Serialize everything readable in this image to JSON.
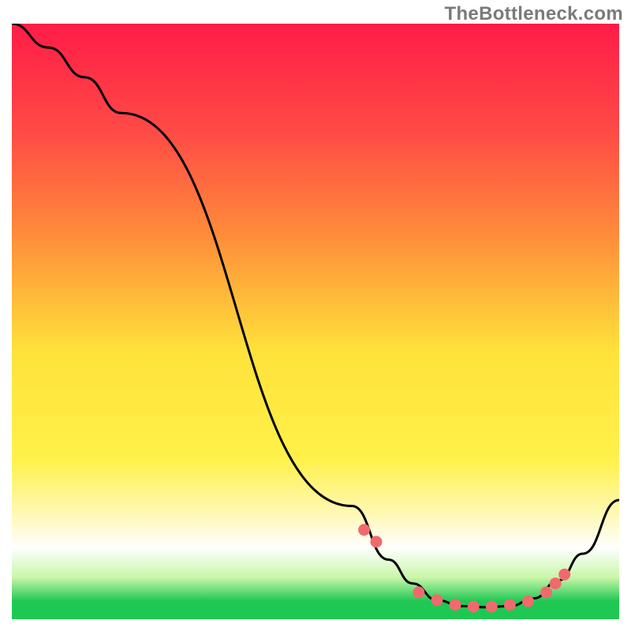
{
  "watermark_text": "TheBottleneck.com",
  "gradient": {
    "top": "#ff1c47",
    "mid_upper": "#ff8a3a",
    "mid": "#ffe23a",
    "mid_lower": "#fff8b0",
    "white_band": "#ffffff",
    "green": "#1ec853"
  },
  "dot_color": "#f06a6d",
  "chart_data": {
    "type": "line",
    "title": "",
    "xlabel": "",
    "ylabel": "",
    "xlim": [
      0,
      100
    ],
    "ylim": [
      0,
      100
    ],
    "series": [
      {
        "name": "curve",
        "x": [
          0,
          6,
          12,
          18,
          56,
          62,
          66,
          70,
          74,
          78,
          82,
          86,
          90,
          94,
          100
        ],
        "y": [
          100,
          96,
          91,
          85,
          19,
          10,
          6,
          3.2,
          2.2,
          2,
          2.2,
          3.5,
          6.5,
          11,
          20
        ]
      }
    ],
    "dots": {
      "x": [
        58,
        60,
        67,
        70,
        73,
        76,
        79,
        82,
        85,
        88,
        89.5,
        91
      ],
      "y": [
        15,
        13,
        4.5,
        3.2,
        2.4,
        2.1,
        2.1,
        2.4,
        3.0,
        4.5,
        6.0,
        7.5
      ]
    }
  }
}
